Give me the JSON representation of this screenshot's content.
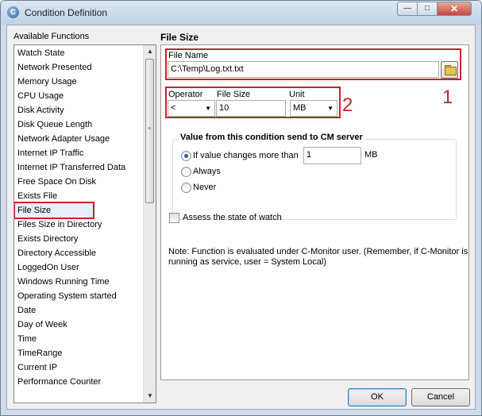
{
  "window": {
    "title": "Condition Definition",
    "app_icon_letter": "C"
  },
  "titlebar_buttons": {
    "minimize_glyph": "—",
    "maximize_glyph": "□",
    "close_glyph": "✕"
  },
  "functions": {
    "heading": "Available Functions",
    "items": [
      "Watch State",
      "Network Presented",
      "Memory Usage",
      "CPU Usage",
      "Disk Activity",
      "Disk Queue Length",
      "Network Adapter Usage",
      "Internet IP Traffic",
      "Internet IP Transferred Data",
      "Free Space On Disk",
      "Exists File",
      "File Size",
      "Files Size in Directory",
      "Exists Directory",
      "Directory Accessible",
      "LoggedOn User",
      "Windows Running Time",
      "Operating System started",
      "Date",
      "Day of Week",
      "Time",
      "TimeRange",
      "Current IP",
      "Performance Counter"
    ],
    "selected": "File Size"
  },
  "panel": {
    "title": "File Size",
    "file_name_label": "File Name",
    "file_name_value": "C:\\Temp\\Log.txt.txt",
    "operator_label": "Operator",
    "operator_value": "<",
    "file_size_label": "File Size",
    "file_size_value": "10",
    "unit_label": "Unit",
    "unit_value": "MB",
    "group_title": "Value from this condition send to CM server",
    "radio_change_label": "If value changes more than",
    "change_value": "1",
    "change_unit": "MB",
    "radio_always_label": "Always",
    "radio_never_label": "Never",
    "selected_send_option": "If value changes more than",
    "assess_label": "Assess the state of watch",
    "assess_checked": false,
    "note_line1": "Note: Function is evaluated under C-Monitor user. (Remember, if C-Monitor is",
    "note_line2": "running as service, user = System Local)"
  },
  "annotations": {
    "marker1": "1",
    "marker2": "2"
  },
  "buttons": {
    "ok": "OK",
    "cancel": "Cancel"
  }
}
